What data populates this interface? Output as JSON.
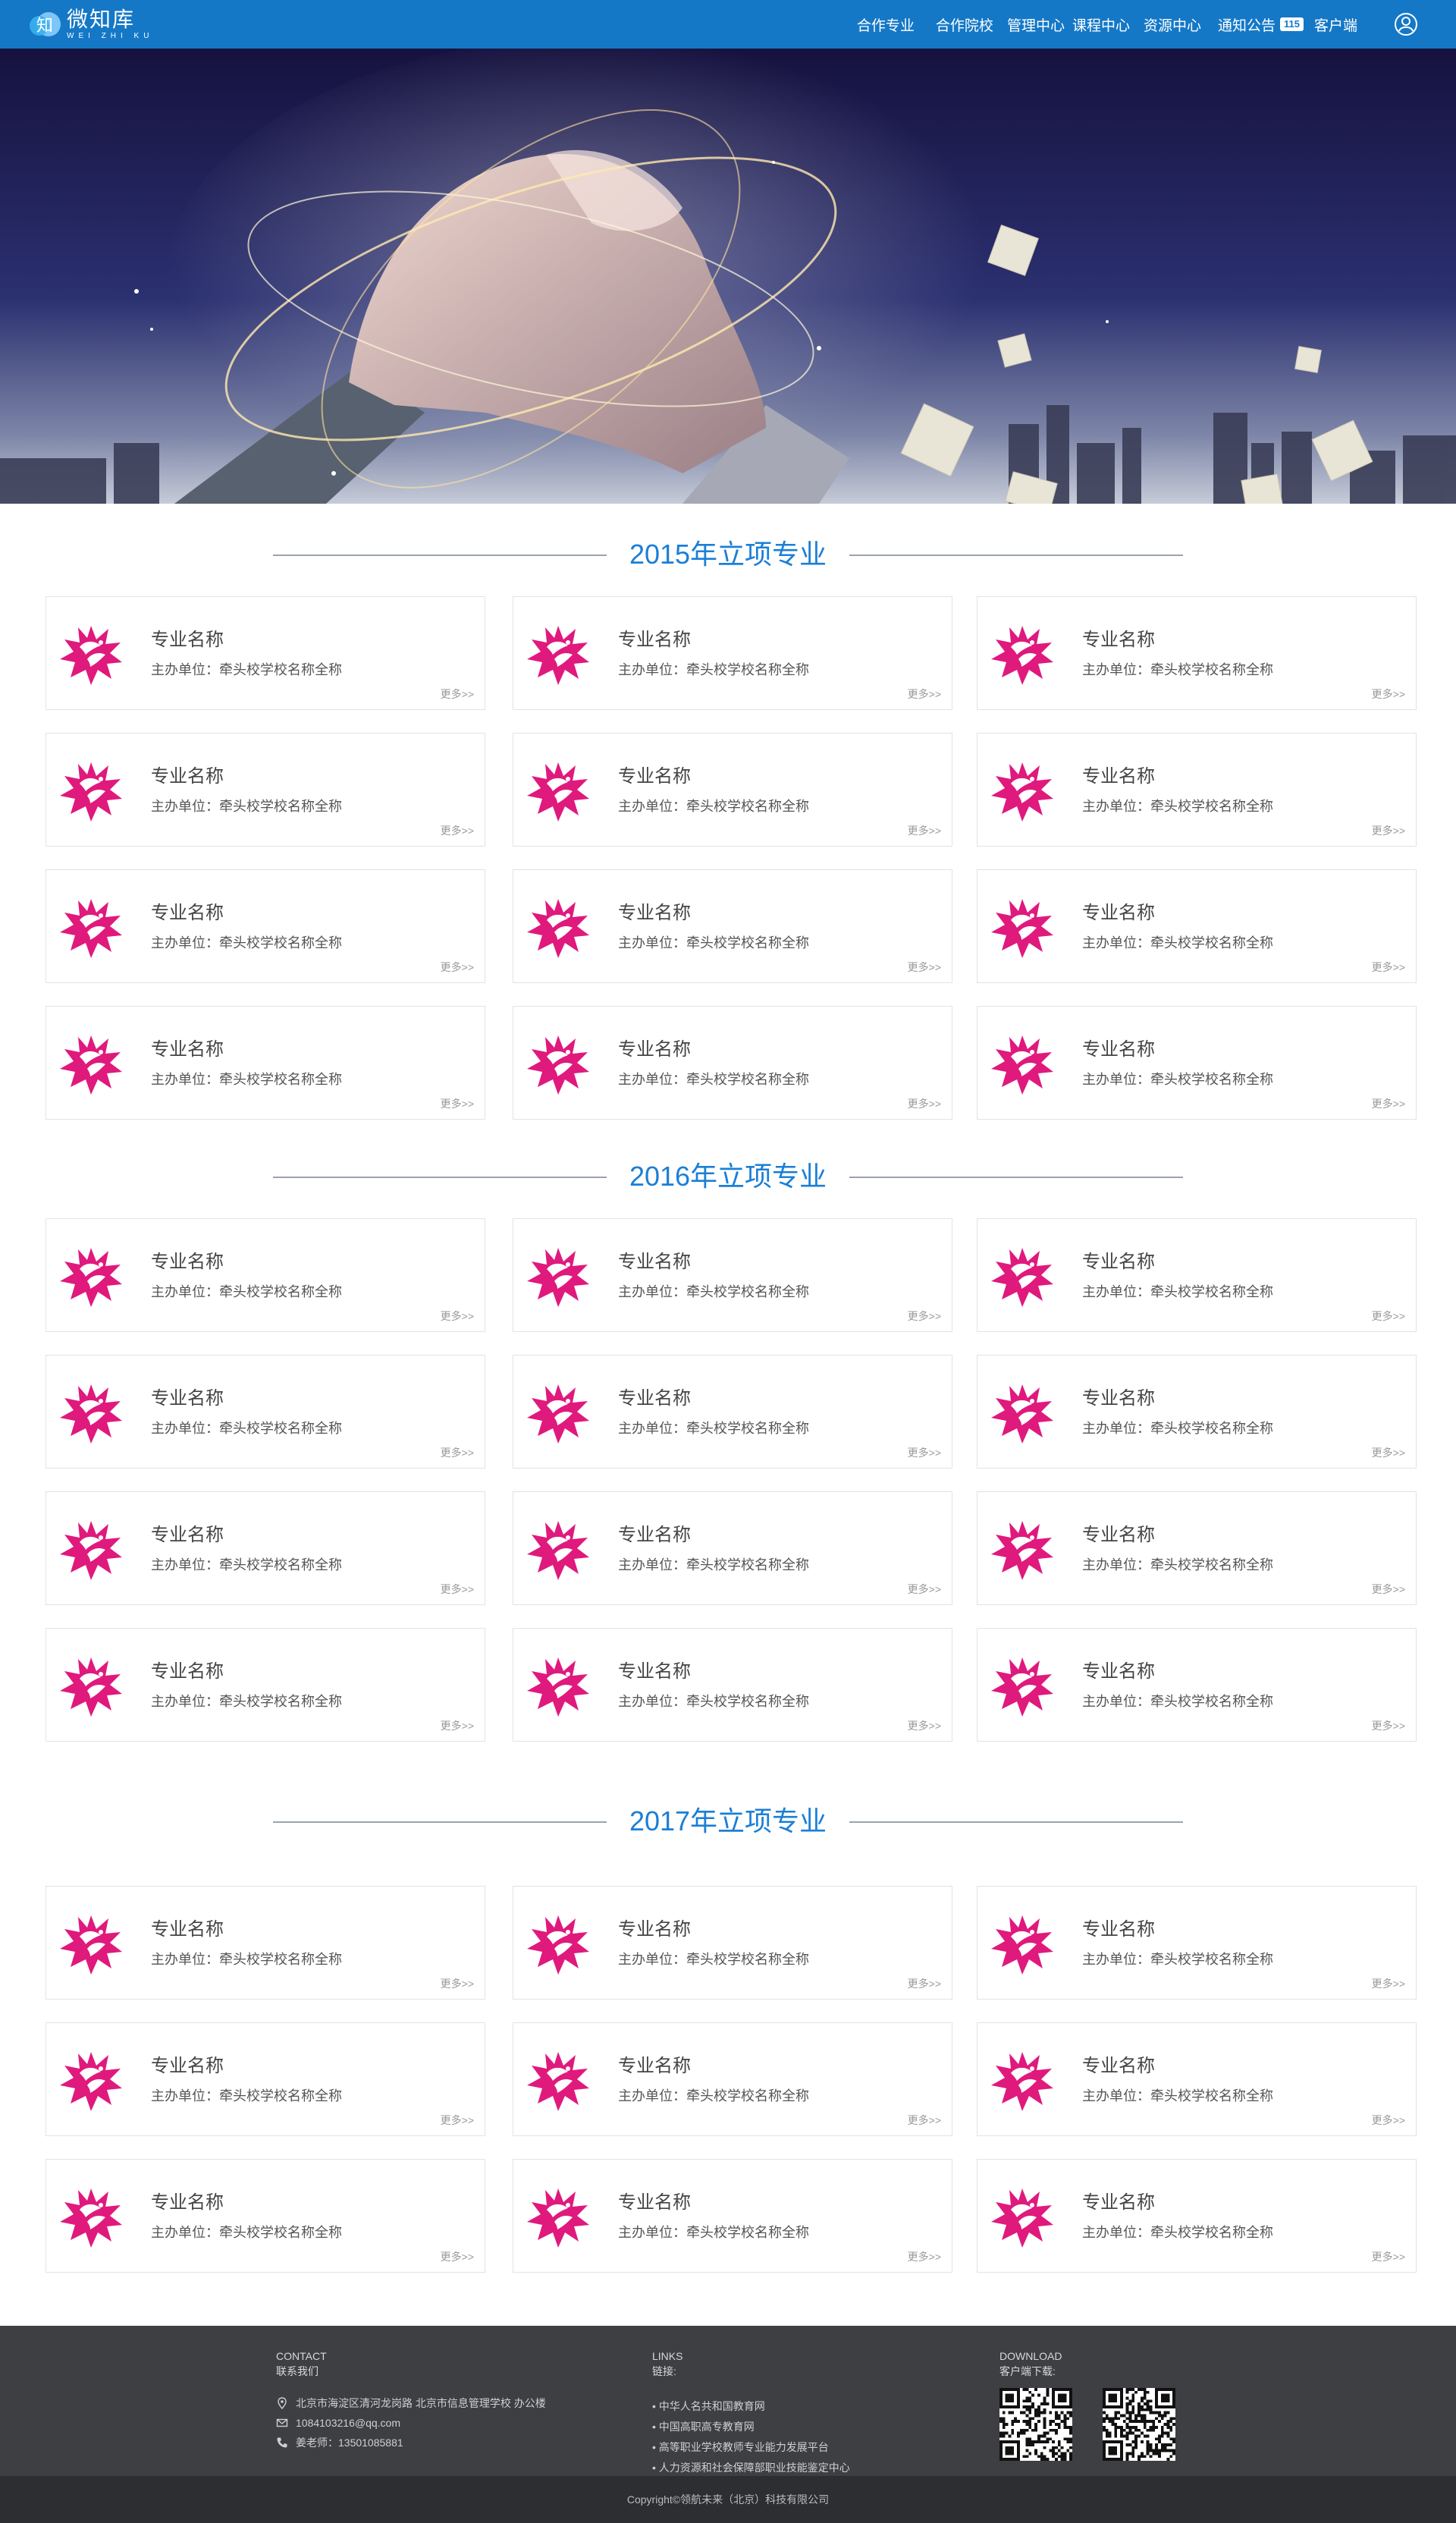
{
  "nav": {
    "logo_cn": "微知库",
    "logo_en": "WEI ZHI KU",
    "logo_glyph": "知",
    "menu": [
      "合作专业",
      "合作院校",
      "管理中心",
      "课程中心",
      "资源中心",
      "通知公告",
      "客户端"
    ],
    "notice_badge": "115",
    "brand_color": "#1478c7"
  },
  "sections": [
    {
      "title": "2015年立项专业",
      "cards": [
        {
          "name": "专业名称",
          "org": "主办单位：牵头校学校名称全称",
          "more": "更多>>"
        },
        {
          "name": "专业名称",
          "org": "主办单位：牵头校学校名称全称",
          "more": "更多>>"
        },
        {
          "name": "专业名称",
          "org": "主办单位：牵头校学校名称全称",
          "more": "更多>>"
        },
        {
          "name": "专业名称",
          "org": "主办单位：牵头校学校名称全称",
          "more": "更多>>"
        },
        {
          "name": "专业名称",
          "org": "主办单位：牵头校学校名称全称",
          "more": "更多>>"
        },
        {
          "name": "专业名称",
          "org": "主办单位：牵头校学校名称全称",
          "more": "更多>>"
        },
        {
          "name": "专业名称",
          "org": "主办单位：牵头校学校名称全称",
          "more": "更多>>"
        },
        {
          "name": "专业名称",
          "org": "主办单位：牵头校学校名称全称",
          "more": "更多>>"
        },
        {
          "name": "专业名称",
          "org": "主办单位：牵头校学校名称全称",
          "more": "更多>>"
        },
        {
          "name": "专业名称",
          "org": "主办单位：牵头校学校名称全称",
          "more": "更多>>"
        },
        {
          "name": "专业名称",
          "org": "主办单位：牵头校学校名称全称",
          "more": "更多>>"
        },
        {
          "name": "专业名称",
          "org": "主办单位：牵头校学校名称全称",
          "more": "更多>>"
        }
      ]
    },
    {
      "title": "2016年立项专业",
      "cards": [
        {
          "name": "专业名称",
          "org": "主办单位：牵头校学校名称全称",
          "more": "更多>>"
        },
        {
          "name": "专业名称",
          "org": "主办单位：牵头校学校名称全称",
          "more": "更多>>"
        },
        {
          "name": "专业名称",
          "org": "主办单位：牵头校学校名称全称",
          "more": "更多>>"
        },
        {
          "name": "专业名称",
          "org": "主办单位：牵头校学校名称全称",
          "more": "更多>>"
        },
        {
          "name": "专业名称",
          "org": "主办单位：牵头校学校名称全称",
          "more": "更多>>"
        },
        {
          "name": "专业名称",
          "org": "主办单位：牵头校学校名称全称",
          "more": "更多>>"
        },
        {
          "name": "专业名称",
          "org": "主办单位：牵头校学校名称全称",
          "more": "更多>>"
        },
        {
          "name": "专业名称",
          "org": "主办单位：牵头校学校名称全称",
          "more": "更多>>"
        },
        {
          "name": "专业名称",
          "org": "主办单位：牵头校学校名称全称",
          "more": "更多>>"
        },
        {
          "name": "专业名称",
          "org": "主办单位：牵头校学校名称全称",
          "more": "更多>>"
        },
        {
          "name": "专业名称",
          "org": "主办单位：牵头校学校名称全称",
          "more": "更多>>"
        },
        {
          "name": "专业名称",
          "org": "主办单位：牵头校学校名称全称",
          "more": "更多>>"
        }
      ]
    },
    {
      "title": "2017年立项专业",
      "cards": [
        {
          "name": "专业名称",
          "org": "主办单位：牵头校学校名称全称",
          "more": "更多>>"
        },
        {
          "name": "专业名称",
          "org": "主办单位：牵头校学校名称全称",
          "more": "更多>>"
        },
        {
          "name": "专业名称",
          "org": "主办单位：牵头校学校名称全称",
          "more": "更多>>"
        },
        {
          "name": "专业名称",
          "org": "主办单位：牵头校学校名称全称",
          "more": "更多>>"
        },
        {
          "name": "专业名称",
          "org": "主办单位：牵头校学校名称全称",
          "more": "更多>>"
        },
        {
          "name": "专业名称",
          "org": "主办单位：牵头校学校名称全称",
          "more": "更多>>"
        },
        {
          "name": "专业名称",
          "org": "主办单位：牵头校学校名称全称",
          "more": "更多>>"
        },
        {
          "name": "专业名称",
          "org": "主办单位：牵头校学校名称全称",
          "more": "更多>>"
        },
        {
          "name": "专业名称",
          "org": "主办单位：牵头校学校名称全称",
          "more": "更多>>"
        }
      ]
    }
  ],
  "footer": {
    "contact_en": "CONTACT",
    "contact_cn": "联系我们",
    "address": "北京市海淀区清河龙岗路 北京市信息管理学校 办公楼",
    "email": "1084103216@qq.com",
    "phone": "姜老师：13501085881",
    "links_en": "LINKS",
    "links_cn": "链接:",
    "links": [
      "• 中华人名共和国教育网",
      "• 中国高职高专教育网",
      "• 高等职业学校教师专业能力发展平台",
      "• 人力资源和社会保障部职业技能鉴定中心"
    ],
    "download_en": "DOWNLOAD",
    "download_cn": "客户端下载:",
    "copyright": "Copyright©领航未来（北京）科技有限公司"
  },
  "colors": {
    "accent": "#1b7fd6",
    "card_icon": "#e0197d",
    "footer_bg": "#3e3f42",
    "copyright_bg": "#2d2e31"
  },
  "icons": [
    "user-icon",
    "flower-logo-icon",
    "location-icon",
    "mail-icon",
    "phone-icon",
    "qr-code-icon"
  ]
}
